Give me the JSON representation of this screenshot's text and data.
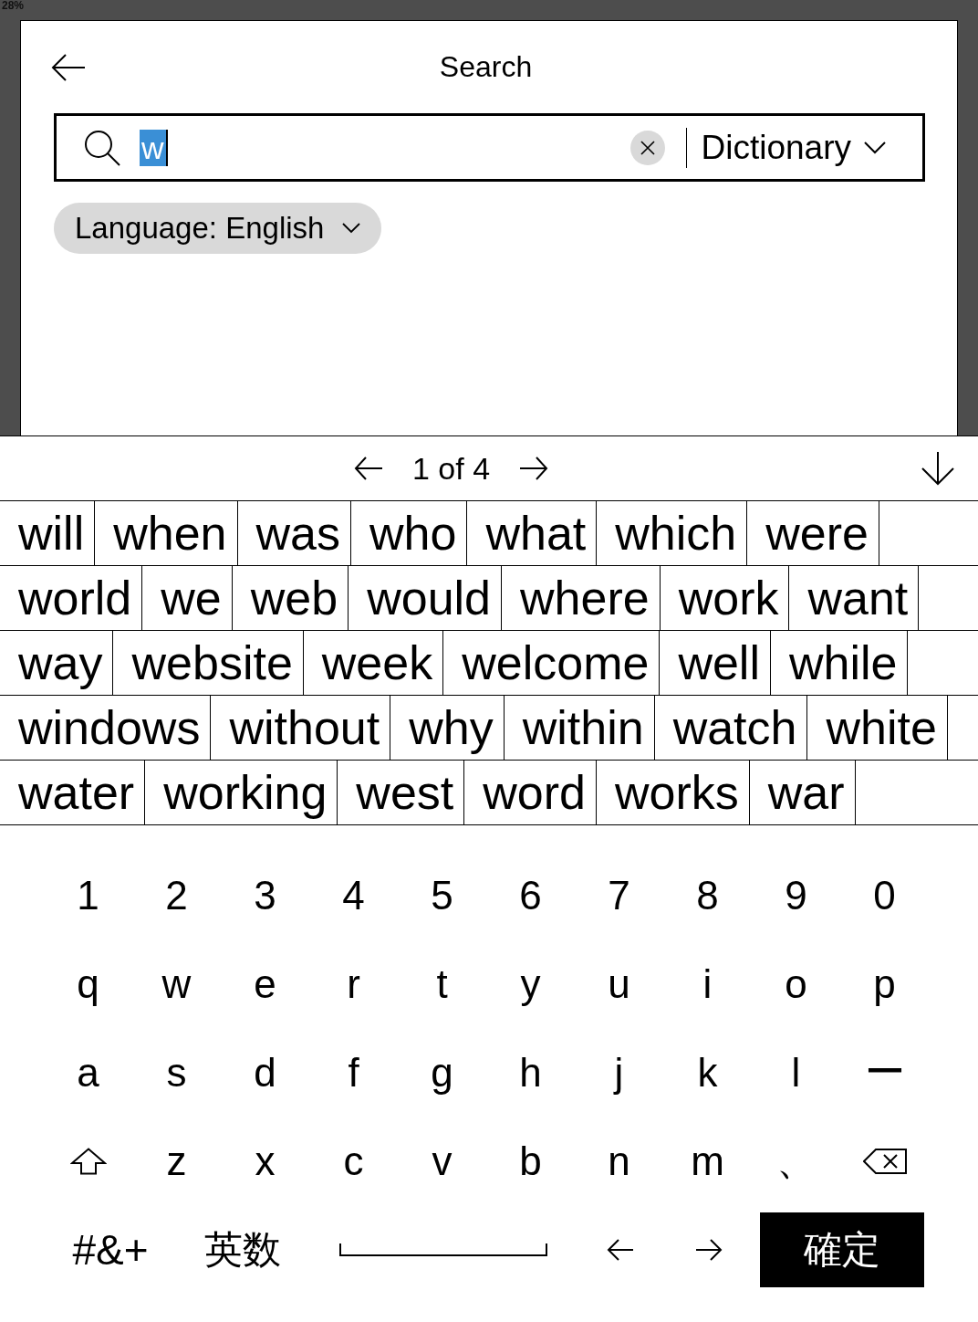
{
  "status_bar": {
    "battery": "28%"
  },
  "header": {
    "title": "Search"
  },
  "search": {
    "value": "w",
    "value_selected": true,
    "scope": "Dictionary"
  },
  "language_filter": {
    "label": "Language: English"
  },
  "pager": {
    "label": "1 of 4"
  },
  "suggestions": [
    [
      "will",
      "when",
      "was",
      "who",
      "what",
      "which",
      "were"
    ],
    [
      "world",
      "we",
      "web",
      "would",
      "where",
      "work",
      "want"
    ],
    [
      "way",
      "website",
      "week",
      "welcome",
      "well",
      "while"
    ],
    [
      "windows",
      "without",
      "why",
      "within",
      "watch",
      "white"
    ],
    [
      "water",
      "working",
      "west",
      "word",
      "works",
      "war"
    ]
  ],
  "keyboard": {
    "rows": [
      [
        {
          "kind": "char",
          "label": "1"
        },
        {
          "kind": "char",
          "label": "2"
        },
        {
          "kind": "char",
          "label": "3"
        },
        {
          "kind": "char",
          "label": "4"
        },
        {
          "kind": "char",
          "label": "5"
        },
        {
          "kind": "char",
          "label": "6"
        },
        {
          "kind": "char",
          "label": "7"
        },
        {
          "kind": "char",
          "label": "8"
        },
        {
          "kind": "char",
          "label": "9"
        },
        {
          "kind": "char",
          "label": "0"
        }
      ],
      [
        {
          "kind": "char",
          "label": "q"
        },
        {
          "kind": "char",
          "label": "w"
        },
        {
          "kind": "char",
          "label": "e"
        },
        {
          "kind": "char",
          "label": "r"
        },
        {
          "kind": "char",
          "label": "t"
        },
        {
          "kind": "char",
          "label": "y"
        },
        {
          "kind": "char",
          "label": "u"
        },
        {
          "kind": "char",
          "label": "i"
        },
        {
          "kind": "char",
          "label": "o"
        },
        {
          "kind": "char",
          "label": "p"
        }
      ],
      [
        {
          "kind": "char",
          "label": "a"
        },
        {
          "kind": "char",
          "label": "s"
        },
        {
          "kind": "char",
          "label": "d"
        },
        {
          "kind": "char",
          "label": "f"
        },
        {
          "kind": "char",
          "label": "g"
        },
        {
          "kind": "char",
          "label": "h"
        },
        {
          "kind": "char",
          "label": "j"
        },
        {
          "kind": "char",
          "label": "k"
        },
        {
          "kind": "char",
          "label": "l"
        },
        {
          "kind": "char",
          "label": "ー"
        }
      ],
      [
        {
          "kind": "shift"
        },
        {
          "kind": "char",
          "label": "z"
        },
        {
          "kind": "char",
          "label": "x"
        },
        {
          "kind": "char",
          "label": "c"
        },
        {
          "kind": "char",
          "label": "v"
        },
        {
          "kind": "char",
          "label": "b"
        },
        {
          "kind": "char",
          "label": "n"
        },
        {
          "kind": "char",
          "label": "m"
        },
        {
          "kind": "char",
          "label": "、"
        },
        {
          "kind": "backspace"
        }
      ]
    ],
    "function_keys": [
      {
        "kind": "symbols",
        "label": "#&+"
      },
      {
        "kind": "mode",
        "label": "英数"
      },
      {
        "kind": "space"
      },
      {
        "kind": "left"
      },
      {
        "kind": "right"
      },
      {
        "kind": "enter",
        "label": "確定"
      }
    ]
  }
}
